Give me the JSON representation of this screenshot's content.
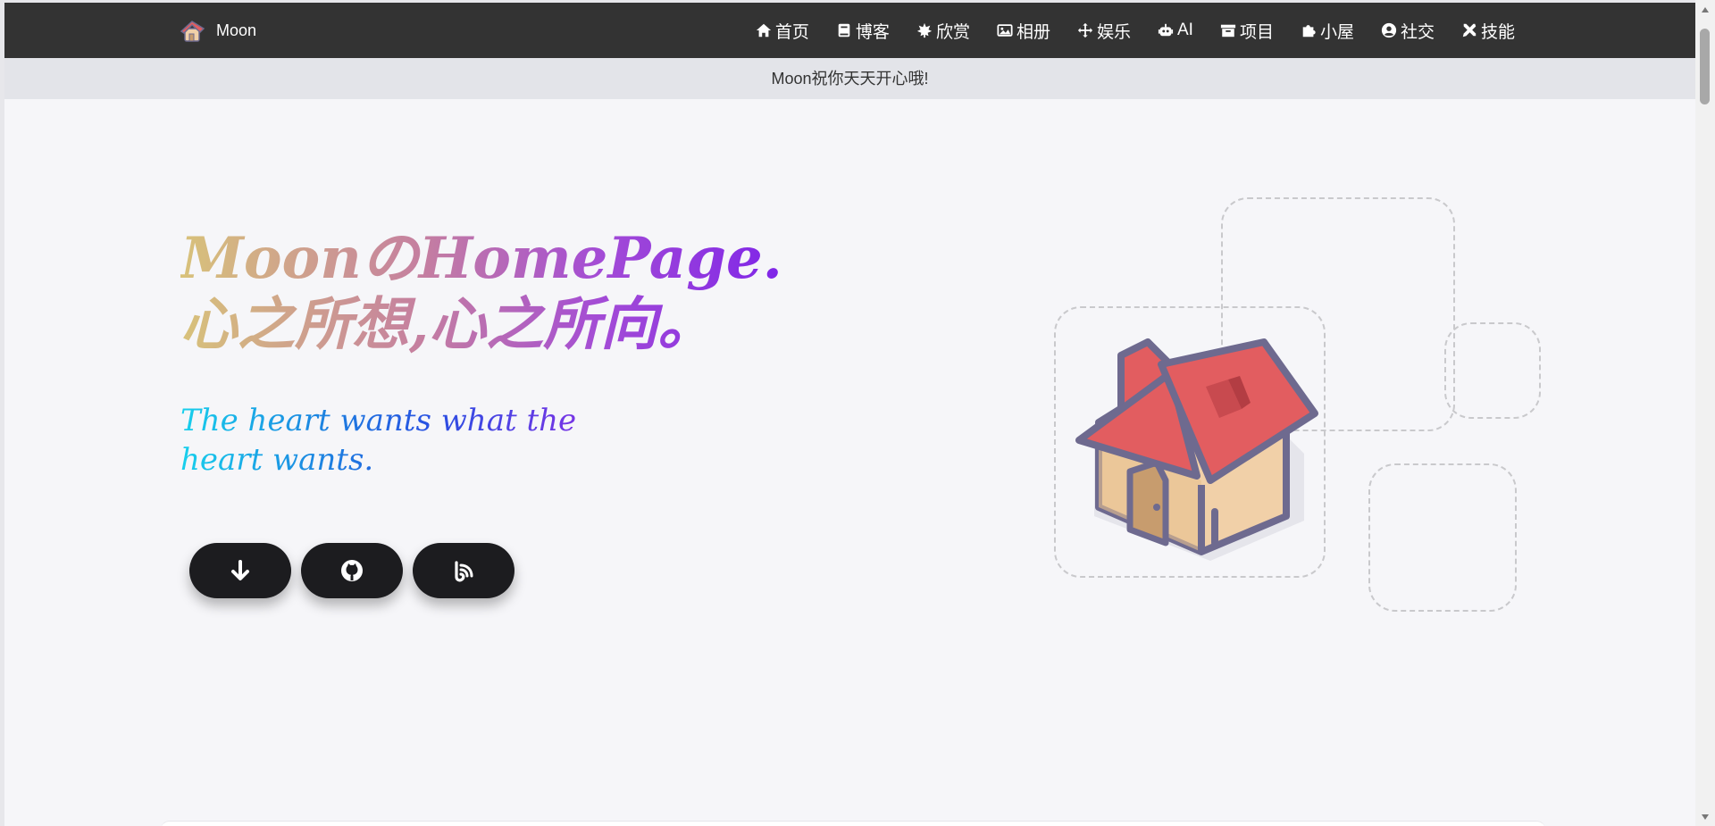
{
  "brand": {
    "name": "Moon",
    "logo_icon": "house-icon"
  },
  "nav": {
    "items": [
      {
        "label": "首页",
        "icon": "home-icon"
      },
      {
        "label": "博客",
        "icon": "book-icon"
      },
      {
        "label": "欣赏",
        "icon": "leaf-icon"
      },
      {
        "label": "相册",
        "icon": "image-icon"
      },
      {
        "label": "娱乐",
        "icon": "move-icon"
      },
      {
        "label": "AI",
        "icon": "robot-icon"
      },
      {
        "label": "项目",
        "icon": "archive-icon"
      },
      {
        "label": "小屋",
        "icon": "puzzle-icon"
      },
      {
        "label": "社交",
        "icon": "user-circle-icon"
      },
      {
        "label": "技能",
        "icon": "tools-icon"
      }
    ]
  },
  "notice": {
    "text": "Moon祝你天天开心哦!"
  },
  "hero": {
    "title_line1": "MoonのHomePage.",
    "title_line2": "心之所想,心之所向。",
    "subtitle": "The heart wants what the heart wants.",
    "buttons": [
      {
        "icon": "arrow-down-icon"
      },
      {
        "icon": "github-icon"
      },
      {
        "icon": "rss-icon"
      }
    ]
  },
  "colors": {
    "navbar_bg": "#333333",
    "notice_bg": "#e3e4e9",
    "page_bg": "#f6f6f9",
    "button_bg": "#1c1c1f",
    "title_gradient": [
      "#d8c27a",
      "#c57fa0",
      "#a34bd6",
      "#7f25e8"
    ],
    "subtitle_gradient": [
      "#18d0ec",
      "#1d7fe0",
      "#2a4ee2",
      "#8a2fe6"
    ]
  }
}
